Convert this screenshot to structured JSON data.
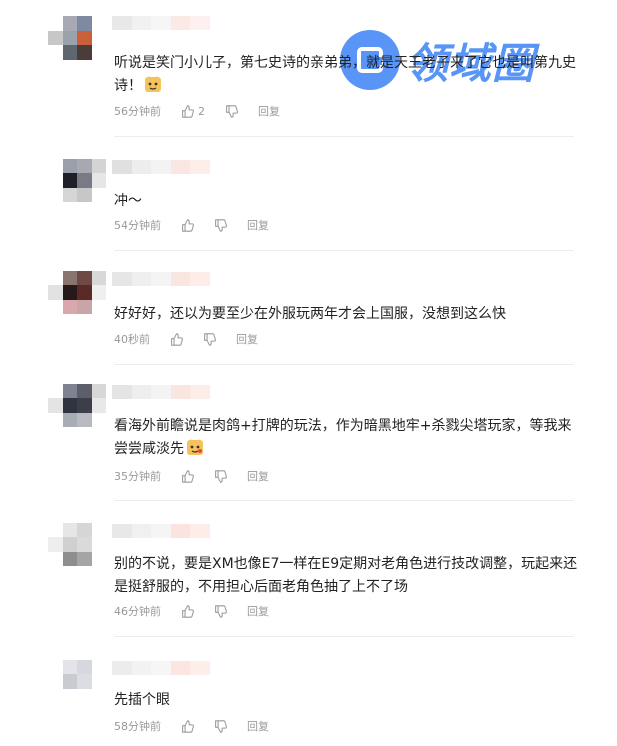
{
  "watermark": {
    "text": "领域圈"
  },
  "comments": [
    {
      "avatar_colors": [
        "#ffffff",
        "#a9a9b5",
        "#7f8aa2",
        "#ffffff",
        "#c7c7c7",
        "#9aa3ab",
        "#c9603a",
        "#ffffff",
        "#ffffff",
        "#5e6670",
        "#4a3c3a",
        "#ffffff",
        "#ffffff",
        "#ffffff",
        "#ffffff",
        "#ffffff"
      ],
      "name_colors": [
        "#e8e8e8",
        "#f1f1f1",
        "#f6f6f6",
        "#fbe9e6",
        "#fdf0ee"
      ],
      "text": "听说是笑门小儿子，第七史诗的亲弟弟，就是天王老子来了它也是叫第九史诗！",
      "emoji": true,
      "time": "56分钟前",
      "likes": "2",
      "reply": "回复"
    },
    {
      "avatar_colors": [
        "#ffffff",
        "#ffffff",
        "#ffffff",
        "#ffffff",
        "#ffffff",
        "#9aa0aa",
        "#a8a8b0",
        "#d4d4d4",
        "#ffffff",
        "#1f1f29",
        "#7a7a85",
        "#e6e6e6",
        "#ffffff",
        "#d5d5d5",
        "#c7c7c7",
        "#ffffff"
      ],
      "name_colors": [
        "#e0e0e0",
        "#ededed",
        "#f3f3f3",
        "#fbe6e3",
        "#fdeeea"
      ],
      "text": "冲～",
      "emoji": false,
      "time": "54分钟前",
      "likes": "",
      "reply": "回复"
    },
    {
      "avatar_colors": [
        "#ffffff",
        "#ffffff",
        "#ffffff",
        "#ffffff",
        "#ffffff",
        "#8a7470",
        "#6d4a46",
        "#d8d8d8",
        "#e2e2e2",
        "#27191a",
        "#5a2a25",
        "#efefef",
        "#ffffff",
        "#d8a8ad",
        "#c8a6a8",
        "#ffffff"
      ],
      "name_colors": [
        "#e6e6e6",
        "#efefef",
        "#f4f4f4",
        "#fbe5e1",
        "#fdece8"
      ],
      "text": "好好好，还以为要至少在外服玩两年才会上国服，没想到这么快",
      "emoji": false,
      "time": "40秒前",
      "likes": "",
      "reply": "回复"
    },
    {
      "avatar_colors": [
        "#ffffff",
        "#ffffff",
        "#ffffff",
        "#ffffff",
        "#ffffff",
        "#7f8290",
        "#5c5e6a",
        "#d7d7d7",
        "#e4e4e4",
        "#303340",
        "#3c3e4a",
        "#e8e8e8",
        "#ffffff",
        "#a8acb4",
        "#b7bac0",
        "#ffffff"
      ],
      "name_colors": [
        "#e4e4e4",
        "#eeeeee",
        "#f4f4f4",
        "#fbe5e0",
        "#fdede9"
      ],
      "text": "看海外前瞻说是肉鸽+打牌的玩法，作为暗黑地牢+杀戮尖塔玩家，等我来尝尝咸淡先",
      "emoji": true,
      "time": "35分钟前",
      "likes": "",
      "reply": "回复"
    },
    {
      "avatar_colors": [
        "#ffffff",
        "#ffffff",
        "#ffffff",
        "#ffffff",
        "#ffffff",
        "#e6e6e6",
        "#d6d6d6",
        "#ffffff",
        "#eeeeee",
        "#d0d0d0",
        "#dadada",
        "#ffffff",
        "#ffffff",
        "#8e8e8e",
        "#a5a5a5",
        "#ffffff"
      ],
      "name_colors": [
        "#e8e8e8",
        "#f0f0f0",
        "#f5f5f5",
        "#fbe4df",
        "#fdece8"
      ],
      "text": "别的不说，要是XM也像E7一样在E9定期对老角色进行技改调整，玩起来还是挺舒服的，不用担心后面老角色抽了上不了场",
      "emoji": false,
      "time": "46分钟前",
      "likes": "",
      "reply": "回复"
    },
    {
      "avatar_colors": [
        "#ffffff",
        "#ffffff",
        "#ffffff",
        "#ffffff",
        "#ffffff",
        "#e3e3e8",
        "#d7d8df",
        "#ffffff",
        "#ffffff",
        "#c9cad2",
        "#dcdde2",
        "#ffffff",
        "#ffffff",
        "#ffffff",
        "#ffffff",
        "#ffffff"
      ],
      "name_colors": [
        "#ececec",
        "#f2f2f2",
        "#f6f6f6",
        "#fbe6e2",
        "#fdeeea"
      ],
      "text": "先插个眼",
      "emoji": false,
      "time": "58分钟前",
      "likes": "",
      "reply": "回复"
    }
  ]
}
